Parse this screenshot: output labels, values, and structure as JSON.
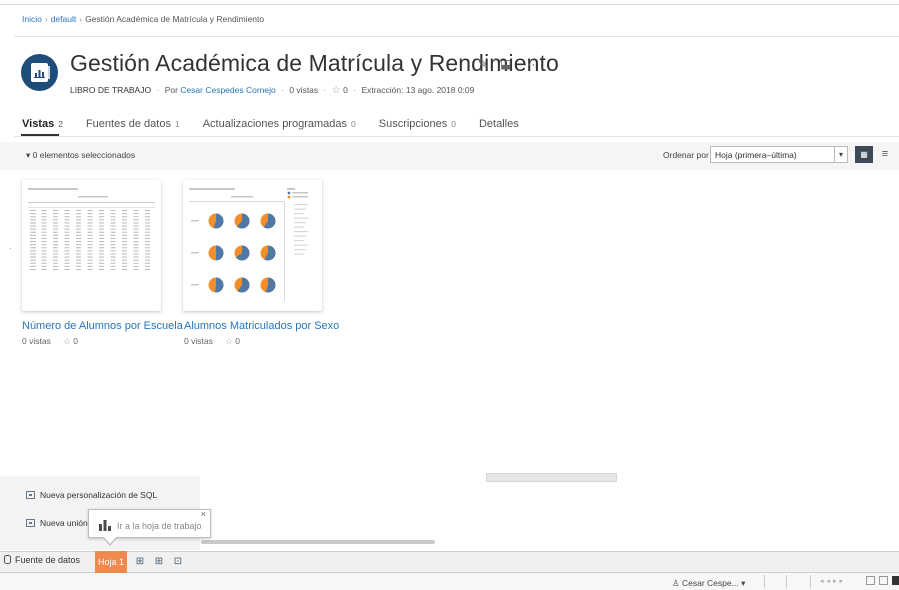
{
  "breadcrumb": {
    "home": "Inicio",
    "project": "default",
    "current": "Gestión Académica de Matrícula y Rendimiento",
    "sep": "›"
  },
  "workbook": {
    "title": "Gestión Académica de Matrícula y Rendimiento",
    "actions": {
      "edit": "✎",
      "subscribe": "⬓",
      "more": "···"
    },
    "type_label": "LIBRO DE TRABAJO",
    "by_prefix": "Por",
    "author": "Cesar Cespedes Cornejo",
    "views_count": "0 vistas",
    "favorites": "0",
    "extract": "Extracción: 13 ago. 2018 0:09"
  },
  "tabs": [
    {
      "label": "Vistas",
      "count": "2",
      "active": true
    },
    {
      "label": "Fuentes de datos",
      "count": "1",
      "active": false
    },
    {
      "label": "Actualizaciones programadas",
      "count": "0",
      "active": false
    },
    {
      "label": "Suscripciones",
      "count": "0",
      "active": false
    },
    {
      "label": "Detalles",
      "count": "",
      "active": false
    }
  ],
  "selection": {
    "text": "▾  0 elementos seleccionados"
  },
  "sort": {
    "label": "Ordenar por",
    "value": "Hoja (primera–última)"
  },
  "cards": [
    {
      "title": "Número de Alumnos por Escuela",
      "views": "0 vistas",
      "favorites": "0"
    },
    {
      "title": "Alumnos Matriculados por Sexo",
      "views": "0 vistas",
      "favorites": "0"
    }
  ],
  "panel": {
    "items": [
      "Nueva personalización de SQL",
      "Nueva unión"
    ]
  },
  "tooltip": {
    "text": "Ir a la hoja de trabajo",
    "close": "×"
  },
  "sheet_tabs": {
    "data_source": "Fuente de datos",
    "active_sheet": "Hoja 1"
  },
  "status": {
    "user": "Cesar Cespe..."
  },
  "colors": {
    "accent_link": "#2875b8",
    "workbook_icon": "#1f4d7a",
    "active_sheet_tab": "#f0894f",
    "pie_blue": "#4e79a7",
    "pie_orange": "#f28e2b"
  }
}
